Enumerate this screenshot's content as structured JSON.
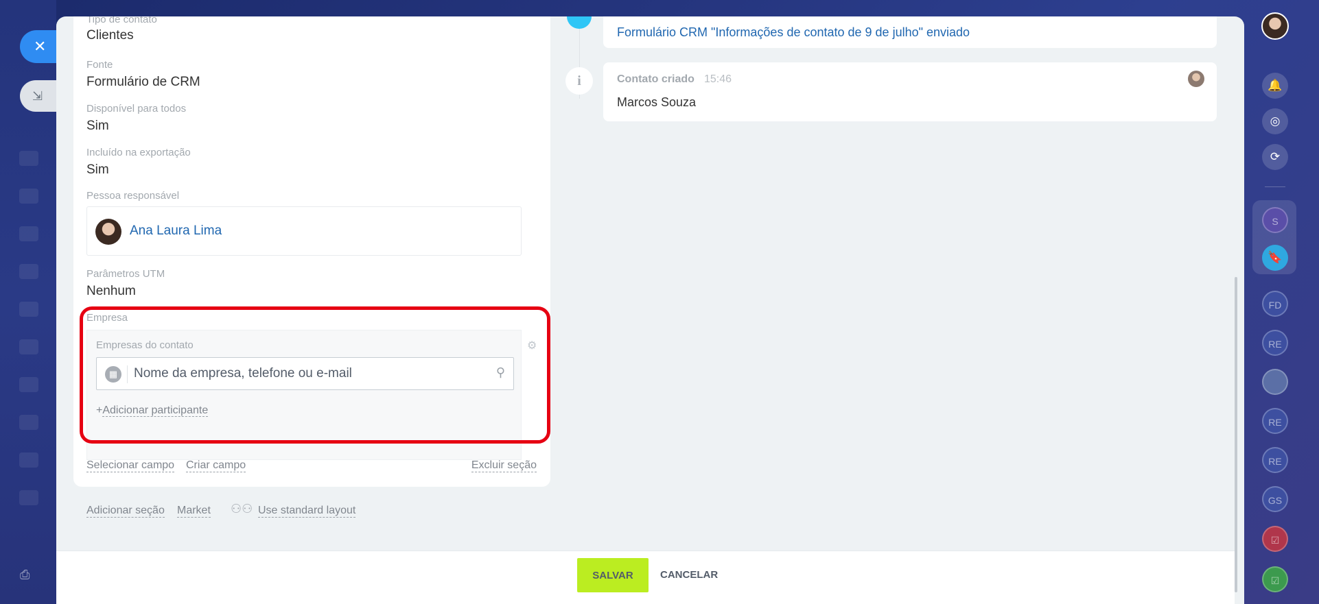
{
  "window": {
    "close_icon": "close-icon",
    "minimize_icon": "collapse-icon",
    "print_icon": "printer-icon"
  },
  "fields": [
    {
      "label": "Tipo de contato",
      "value": "Clientes"
    },
    {
      "label": "Fonte",
      "value": "Formulário de CRM"
    },
    {
      "label": "Disponível para todos",
      "value": "Sim"
    },
    {
      "label": "Incluído na exportação",
      "value": "Sim"
    },
    {
      "label": "Pessoa responsável",
      "value": "Ana Laura Lima"
    },
    {
      "label": "Parâmetros UTM",
      "value": "Nenhum"
    }
  ],
  "empresa": {
    "label": "Empresa",
    "sublabel": "Empresas do contato",
    "search_placeholder": "Nome da empresa, telefone ou e-mail",
    "add_participant_prefix": "+",
    "add_participant": "Adicionar participante"
  },
  "card_links": {
    "select_field": "Selecionar campo",
    "create_field": "Criar campo",
    "delete_section": "Excluir seção"
  },
  "bottom_links": {
    "add_section": "Adicionar seção",
    "market": "Market",
    "standard_layout": "Use standard layout"
  },
  "timeline": {
    "form_link": "Formulário CRM \"Informações de contato de 9 de julho\" enviado",
    "info_glyph": "i",
    "event_title": "Contato criado",
    "event_time": "15:46",
    "event_name": "Marcos Souza"
  },
  "footer": {
    "save": "SALVAR",
    "cancel": "CANCELAR"
  },
  "rail": {
    "circles": [
      "S",
      "FD",
      "RE",
      "RE",
      "RE",
      "GS"
    ]
  },
  "colors": {
    "accent_blue": "#2f8cf2",
    "link_blue": "#2067b0",
    "save_green": "#bbed21",
    "highlight_red": "#e60012"
  }
}
